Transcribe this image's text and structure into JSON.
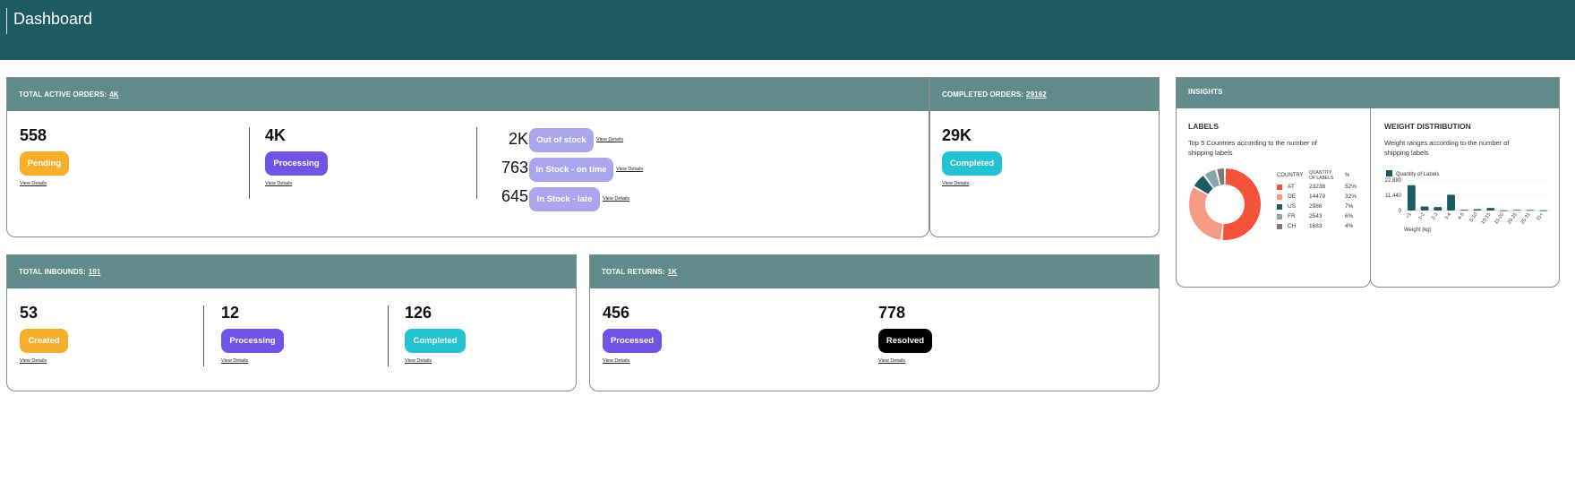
{
  "header": {
    "title": "Dashboard"
  },
  "active_orders": {
    "label": "TOTAL ACTIVE ORDERS:",
    "total": "4K",
    "pending": {
      "count": "558",
      "label": "Pending",
      "link": "View Details"
    },
    "processing": {
      "count": "4K",
      "label": "Processing",
      "link": "View Details"
    },
    "out_of_stock": {
      "count": "2K",
      "label": "Out of stock",
      "link": "View Details"
    },
    "in_stock_on_time": {
      "count": "763",
      "label": "In Stock - on time",
      "link": "View Details"
    },
    "in_stock_late": {
      "count": "645",
      "label": "In Stock - late",
      "link": "View Details"
    }
  },
  "completed_orders": {
    "label": "COMPLETED ORDERS:",
    "total": "29162",
    "count": "29K",
    "status": "Completed",
    "link": "View Details"
  },
  "inbounds": {
    "label": "TOTAL INBOUNDS:",
    "total": "191",
    "created": {
      "count": "53",
      "label": "Created",
      "link": "View Details"
    },
    "processing": {
      "count": "12",
      "label": "Processing",
      "link": "View Details"
    },
    "completed": {
      "count": "126",
      "label": "Completed",
      "link": "View Details"
    }
  },
  "returns": {
    "label": "TOTAL RETURNS:",
    "total": "1K",
    "processed": {
      "count": "456",
      "label": "Processed",
      "link": "View Details"
    },
    "resolved": {
      "count": "778",
      "label": "Resolved",
      "link": "View Details"
    }
  },
  "insights": {
    "title": "INSIGHTS",
    "labels": {
      "title": "LABELS",
      "subtitle_line1": "Top 5 Countries according to the number of",
      "subtitle_line2": "shipping labels",
      "col_country": "COUNTRY",
      "col_qty_line1": "QUANTITY",
      "col_qty_line2": "OF LABELS",
      "col_pct": "%",
      "rows": [
        {
          "country": "AT",
          "qty": "23238",
          "pct": "52%",
          "color": "#f4533a",
          "value": 52
        },
        {
          "country": "DE",
          "qty": "14479",
          "pct": "32%",
          "color": "#f59a85",
          "value": 32
        },
        {
          "country": "US",
          "qty": "2986",
          "pct": "7%",
          "color": "#1d5a61",
          "value": 7
        },
        {
          "country": "FR",
          "qty": "2543",
          "pct": "6%",
          "color": "#86a6a7",
          "value": 6
        },
        {
          "country": "CH",
          "qty": "1683",
          "pct": "4%",
          "color": "#7a7a7a",
          "value": 4
        }
      ]
    },
    "weight": {
      "title": "WEIGHT DISTRIBUTION",
      "subtitle_line1": "Weight ranges according to the number of",
      "subtitle_line2": "shipping labels"
    }
  },
  "chart_data": {
    "type": "bar",
    "legend": "Quantity of Labels",
    "xlabel": "Weight (kg)",
    "yticks": [
      "22.880",
      "11.440",
      "0"
    ],
    "ylim": [
      0,
      22880
    ],
    "categories": [
      "<1",
      "1-2",
      "2-3",
      "3-4",
      "4-5",
      "5-10",
      "10-15",
      "15-20",
      "20-25",
      "25-31",
      "31<"
    ],
    "values": [
      19000,
      3000,
      2600,
      11900,
      600,
      1000,
      1900,
      150,
      500,
      400,
      150
    ],
    "color": "#1d5a61"
  }
}
